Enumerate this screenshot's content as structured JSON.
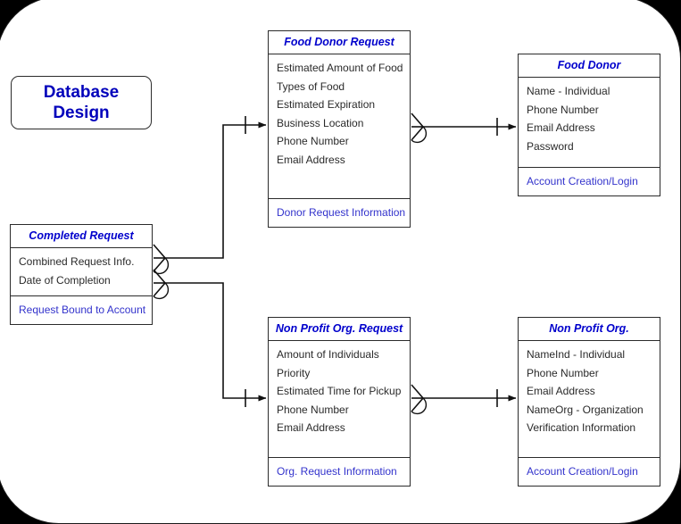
{
  "diagram": {
    "title_box": {
      "line1": "Database",
      "line2": "Design"
    },
    "entities": [
      {
        "id": "food-donor-request",
        "name": "Food Donor Request",
        "attributes": [
          "Estimated Amount of Food",
          "Types of Food",
          "Estimated Expiration",
          "Business Location",
          "Phone Number",
          "Email Address"
        ],
        "footer": "Donor Request Information"
      },
      {
        "id": "food-donor",
        "name": "Food Donor",
        "attributes": [
          "Name - Individual",
          "Phone Number",
          "Email Address",
          "Password"
        ],
        "footer": "Account Creation/Login"
      },
      {
        "id": "completed-request",
        "name": "Completed Request",
        "attributes": [
          "Combined Request Info.",
          "Date of Completion"
        ],
        "footer": "Request Bound to Account"
      },
      {
        "id": "non-profit-org-request",
        "name": "Non Profit Org. Request",
        "attributes": [
          "Amount of Individuals",
          "Priority",
          "Estimated Time for Pickup",
          "Phone Number",
          "Email Address"
        ],
        "footer": "Org. Request Information"
      },
      {
        "id": "non-profit-org",
        "name": "Non Profit Org.",
        "attributes": [
          "NameInd - Individual",
          "Phone Number",
          "Email Address",
          "NameOrg - Organization",
          "Verification Information"
        ],
        "footer": "Account Creation/Login"
      }
    ],
    "relationships": [
      {
        "id": "rel-donor-request-to-donor",
        "from": "food-donor-request",
        "to": "food-donor",
        "from_cardinality": "many",
        "to_cardinality": "one"
      },
      {
        "id": "rel-completed-to-donor-request",
        "from": "completed-request",
        "to": "food-donor-request",
        "from_cardinality": "many",
        "to_cardinality": "one"
      },
      {
        "id": "rel-completed-to-org-request",
        "from": "completed-request",
        "to": "non-profit-org-request",
        "from_cardinality": "many",
        "to_cardinality": "one"
      },
      {
        "id": "rel-org-request-to-org",
        "from": "non-profit-org-request",
        "to": "non-profit-org",
        "from_cardinality": "many",
        "to_cardinality": "one"
      }
    ],
    "colors": {
      "entity_header_text": "#0000cc",
      "entity_footer_text": "#3333cc",
      "attribute_text": "#2a2a2a",
      "title_text": "#0000bb",
      "border": "#2b2b2b",
      "canvas": "#ffffff",
      "backdrop": "#000000"
    }
  }
}
